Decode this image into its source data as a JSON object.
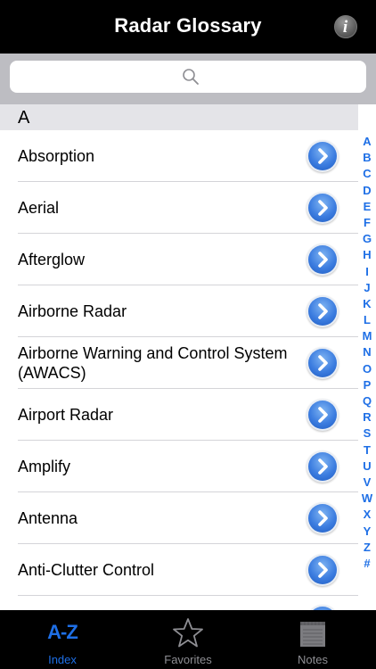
{
  "navbar": {
    "title": "Radar Glossary",
    "info_label": "i"
  },
  "search": {
    "placeholder": ""
  },
  "section": {
    "letter": "A"
  },
  "rows": [
    {
      "label": "Absorption"
    },
    {
      "label": "Aerial"
    },
    {
      "label": "Afterglow"
    },
    {
      "label": "Airborne Radar"
    },
    {
      "label": "Airborne Warning and Control System (AWACS)"
    },
    {
      "label": "Airport Radar"
    },
    {
      "label": "Amplify"
    },
    {
      "label": "Antenna"
    },
    {
      "label": "Anti-Clutter Control"
    }
  ],
  "index": [
    "A",
    "B",
    "C",
    "D",
    "E",
    "F",
    "G",
    "H",
    "I",
    "J",
    "K",
    "L",
    "M",
    "N",
    "O",
    "P",
    "Q",
    "R",
    "S",
    "T",
    "U",
    "V",
    "W",
    "X",
    "Y",
    "Z",
    "#"
  ],
  "tabs": {
    "index": {
      "icon_text": "A-Z",
      "label": "Index"
    },
    "favorites": {
      "label": "Favorites"
    },
    "notes": {
      "label": "Notes"
    }
  },
  "colors": {
    "accent": "#1e6fe6",
    "tab_inactive": "#8e8e93",
    "disclosure": "#3c7de0"
  }
}
